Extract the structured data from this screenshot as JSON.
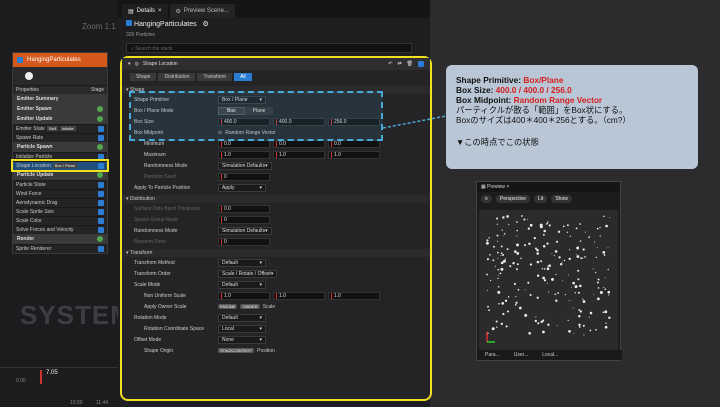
{
  "graph": {
    "zoom": "Zoom 1:1",
    "watermark": "SYSTEM",
    "emitter_name": "HangingParticulates",
    "header_tabs": [
      "Properties",
      "Stage"
    ],
    "rows": [
      {
        "t": "sec",
        "label": "Emitter Summary"
      },
      {
        "t": "sec",
        "label": "Emitter Spawn",
        "icon": "plus"
      },
      {
        "t": "sec",
        "label": "Emitter Update",
        "icon": "plus"
      },
      {
        "t": "row",
        "label": "Emitter State",
        "tag": "Self",
        "tag2": "Infinite"
      },
      {
        "t": "row",
        "label": "Spawn Rate"
      },
      {
        "t": "sec",
        "label": "Particle Spawn",
        "icon": "plus"
      },
      {
        "t": "row",
        "label": "Initialize Particle"
      },
      {
        "t": "row",
        "label": "Shape Location",
        "tag": "Box / Plane",
        "hl": true
      },
      {
        "t": "sec",
        "label": "Particle Update",
        "icon": "plus"
      },
      {
        "t": "row",
        "label": "Particle State"
      },
      {
        "t": "row",
        "label": "Wind Force"
      },
      {
        "t": "row",
        "label": "Aerodynamic Drag"
      },
      {
        "t": "row",
        "label": "Scale Sprite Size"
      },
      {
        "t": "row",
        "label": "Scale Color"
      },
      {
        "t": "row",
        "label": "Solve Forces and Velocity"
      },
      {
        "t": "sec",
        "label": "Render",
        "icon": "plus"
      },
      {
        "t": "row",
        "label": "Sprite Renderer"
      }
    ],
    "timeline": {
      "time": "7.05",
      "t1": "0.00",
      "t2": "10.50",
      "t3": "11.44"
    }
  },
  "details": {
    "tabs": [
      "Details",
      "Preview Scene..."
    ],
    "emitter": "HangingParticulates",
    "particles": "326 Particles",
    "search_placeholder": "Search the stack"
  },
  "panel": {
    "title": "Shape Location",
    "filters": [
      "Shape",
      "Distribution",
      "Transform",
      "All"
    ],
    "sections": [
      {
        "name": "Shape",
        "rows": [
          {
            "label": "Shape Primitive",
            "kind": "dd",
            "v": "Box / Plane"
          },
          {
            "label": "Box / Plane Mode",
            "kind": "seg",
            "v": [
              "Box",
              "Plane"
            ]
          },
          {
            "label": "Box Size",
            "kind": "nums",
            "v": [
              "400.0",
              "400.0",
              "256.0"
            ]
          },
          {
            "label": "Box Midpoint",
            "kind": "txt",
            "v": "Random Range Vector"
          },
          {
            "label": "Minimum",
            "kind": "nums",
            "ind": true,
            "v": [
              "0.0",
              "0.0",
              "0.0"
            ]
          },
          {
            "label": "Maximum",
            "kind": "nums",
            "ind": true,
            "v": [
              "1.0",
              "1.0",
              "1.0"
            ]
          },
          {
            "label": "Randomness Mode",
            "kind": "dd",
            "ind": true,
            "v": "Simulation Defaults"
          },
          {
            "label": "Random Seed",
            "kind": "num1",
            "ind": true,
            "dim": true,
            "v": "0"
          },
          {
            "label": "Apply To Particle Position",
            "kind": "dd",
            "v": "Apply"
          }
        ]
      },
      {
        "name": "Distribution",
        "rows": [
          {
            "label": "Surface Only Band Thickness",
            "kind": "num1",
            "dim": true,
            "v": "0.0"
          },
          {
            "label": "Spawn Group Mask",
            "kind": "num1",
            "dim": true,
            "v": "0"
          },
          {
            "label": "Randomness Mode",
            "kind": "dd",
            "v": "Simulation Defaults"
          },
          {
            "label": "Random Seed",
            "kind": "num1",
            "dim": true,
            "v": "0"
          }
        ]
      },
      {
        "name": "Transform",
        "rows": [
          {
            "label": "Transform Method",
            "kind": "dd",
            "v": "Default"
          },
          {
            "label": "Transform Order",
            "kind": "dd",
            "v": "Scale / Rotate / Offset"
          },
          {
            "label": "Scale Mode",
            "kind": "dd",
            "v": "Default"
          },
          {
            "label": "Non Uniform Scale",
            "kind": "nums",
            "ind": true,
            "v": [
              "1.0",
              "1.0",
              "1.0"
            ]
          },
          {
            "label": "Apply Owner Scale",
            "kind": "pills",
            "ind": true,
            "v": [
              "ENGINE",
              "OWNER"
            ],
            "suffix": "Scale"
          },
          {
            "label": "Rotation Mode",
            "kind": "dd",
            "v": "Default"
          },
          {
            "label": "Rotation Coordinate Space",
            "kind": "dd",
            "ind": true,
            "v": "Local"
          },
          {
            "label": "Offset Mode",
            "kind": "dd",
            "v": "None"
          },
          {
            "label": "Shape Origin",
            "kind": "pills",
            "ind": true,
            "v": [
              "STACKCONTEXT"
            ],
            "suffix": "Position"
          }
        ]
      }
    ]
  },
  "callout": {
    "l1k": "Shape Primitive: ",
    "l1v": "Box/Plane",
    "l2k": "Box Size: ",
    "l2v": "400.0 / 400.0 / 256.0",
    "l3k": "Box Midpoint: ",
    "l3v": "Random Range Vector",
    "l4": "パーティクルが散る「範囲」をBox状にする。",
    "l5": "Boxのサイズは400＊400＊256とする。（cm?）",
    "note": "▼この時点でこの状態"
  },
  "preview": {
    "tab": "Preview",
    "buttons": [
      "Perspective",
      "Lit",
      "Show"
    ],
    "footer": [
      "Para...",
      "User...",
      "Local..."
    ]
  },
  "colors": {
    "accent": "#f0e020",
    "brand": "#d5581c",
    "blue": "#2b7cd3",
    "highlight_red": "#d42020"
  }
}
